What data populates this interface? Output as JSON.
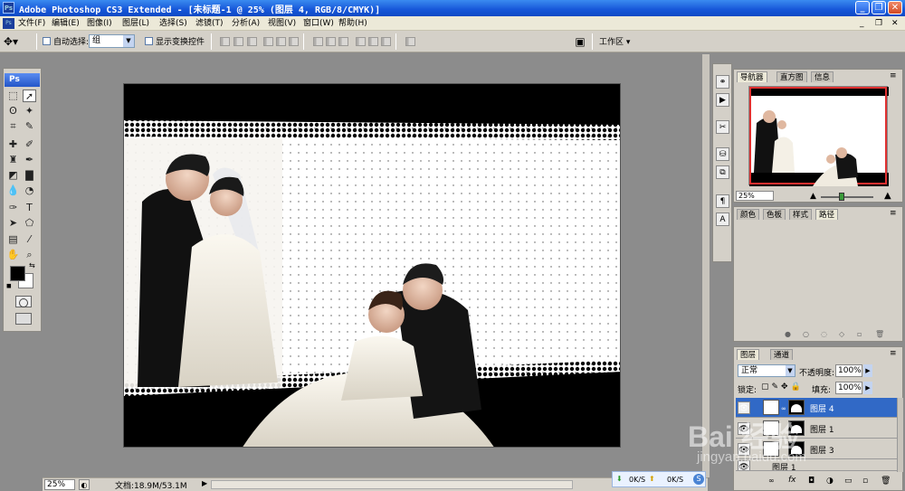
{
  "window": {
    "title": "Adobe Photoshop CS3 Extended - [未标题-1 @ 25% (图层 4, RGB/8/CMYK)]",
    "app_icon": "Ps",
    "minimize_label": "_",
    "restore_label": "❐",
    "close_label": "✕"
  },
  "menu": {
    "app_icon": "Ps",
    "items": [
      "文件(F)",
      "编辑(E)",
      "图像(I)",
      "图层(L)",
      "选择(S)",
      "滤镜(T)",
      "分析(A)",
      "视图(V)",
      "窗口(W)",
      "帮助(H)"
    ],
    "min_label": "_",
    "restore_label": "❐",
    "close_label": "✕"
  },
  "options": {
    "auto_select_label": "自动选择:",
    "auto_select_value": "组",
    "show_transform_label": "显示变换控件",
    "workspace_label": "工作区 ▾"
  },
  "toolbar": {
    "header": "Ps",
    "tools": [
      "move-tool",
      "marquee-tool",
      "lasso-tool",
      "magic-wand-tool",
      "crop-tool",
      "slice-tool",
      "healing-tool",
      "brush-tool",
      "stamp-tool",
      "history-brush-tool",
      "eraser-tool",
      "gradient-tool",
      "blur-tool",
      "dodge-tool",
      "pen-tool",
      "type-tool",
      "path-select-tool",
      "shape-tool",
      "notes-tool",
      "eyedropper-tool",
      "hand-tool",
      "zoom-tool"
    ],
    "foreground_color": "#000000",
    "background_color": "#ffffff"
  },
  "status": {
    "zoom": "25%",
    "doc_size": "文档:18.9M/53.1M"
  },
  "network": {
    "down": "0K/S",
    "up": "0K/S"
  },
  "navigator": {
    "tabs": [
      "导航器",
      "直方图",
      "信息"
    ],
    "zoom": "25%"
  },
  "color_panel": {
    "tabs": [
      "颜色",
      "色板",
      "样式",
      "路径"
    ]
  },
  "layers_panel": {
    "tabs": [
      "图层",
      "通道"
    ],
    "blend_mode": "正常",
    "opacity_label": "不透明度:",
    "opacity_value": "100%",
    "lock_label": "锁定:",
    "fill_label": "填充:",
    "fill_value": "100%",
    "layers": [
      {
        "name": "图层 4",
        "active": true
      },
      {
        "name": "图层 1",
        "active": false
      },
      {
        "name": "图层 3",
        "active": false
      },
      {
        "name": "图层 1",
        "active": false
      }
    ]
  },
  "watermark": {
    "line1": "Bai 经验",
    "line2": "jingyan.baidu.com"
  },
  "colors": {
    "titlebar": "#1656d8",
    "active_layer": "#3169c6",
    "canvas_black": "#000000",
    "nav_frame": "#e03030"
  }
}
